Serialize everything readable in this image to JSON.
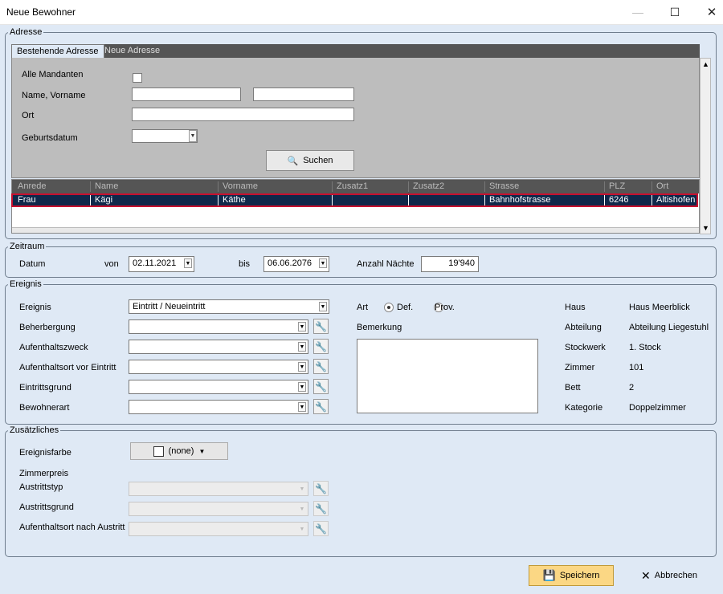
{
  "window": {
    "title": "Neue Bewohner",
    "minimize": "—",
    "maximize": "☐",
    "close": "✕"
  },
  "adresse": {
    "legend": "Adresse",
    "tabs": [
      "Bestehende Adresse",
      "Neue Adresse"
    ],
    "alle_mandanten_label": "Alle Mandanten",
    "name_vorname_label": "Name, Vorname",
    "ort_label": "Ort",
    "geburtsdatum_label": "Geburtsdatum",
    "suchen_label": "Suchen",
    "columns": [
      "Anrede",
      "Name",
      "Vorname",
      "Zusatz1",
      "Zusatz2",
      "Strasse",
      "PLZ",
      "Ort"
    ],
    "rows": [
      [
        "Frau",
        "Kägi",
        "Käthe",
        "",
        "",
        "Bahnhofstrasse",
        "6246",
        "Altishofen"
      ]
    ]
  },
  "zeitraum": {
    "legend": "Zeitraum",
    "datum_label": "Datum",
    "von_label": "von",
    "von_value": "02.11.2021",
    "bis_label": "bis",
    "bis_value": "06.06.2076",
    "naechte_label": "Anzahl Nächte",
    "naechte_value": "19'940"
  },
  "ereignis": {
    "legend": "Ereignis",
    "ereignis_label": "Ereignis",
    "ereignis_value": "Eintritt / Neueintritt",
    "beherbergung_label": "Beherbergung",
    "aufenthaltszweck_label": "Aufenthaltszweck",
    "aufenthaltsort_label": "Aufenthaltsort vor Eintritt",
    "eintrittsgrund_label": "Eintrittsgrund",
    "bewohnerart_label": "Bewohnerart",
    "art_label": "Art",
    "def_label": "Def.",
    "prov_label": "Prov.",
    "bemerkung_label": "Bemerkung",
    "info": [
      {
        "label": "Haus",
        "value": "Haus Meerblick"
      },
      {
        "label": "Abteilung",
        "value": "Abteilung Liegestuhl"
      },
      {
        "label": "Stockwerk",
        "value": "1. Stock"
      },
      {
        "label": "Zimmer",
        "value": "101"
      },
      {
        "label": "Bett",
        "value": "2"
      },
      {
        "label": "Kategorie",
        "value": "Doppelzimmer"
      }
    ]
  },
  "zusaetzliches": {
    "legend": "Zusätzliches",
    "ereignisfarbe_label": "Ereignisfarbe",
    "ereignisfarbe_value": "(none)",
    "zimmerpreis_label": "Zimmerpreis",
    "austrittstyp_label": "Austrittstyp",
    "austrittsgrund_label": "Austrittsgrund",
    "aufenthaltsort_nach_label": "Aufenthaltsort nach Austritt"
  },
  "footer": {
    "speichern_label": "Speichern",
    "abbrechen_label": "Abbrechen"
  },
  "colors": {
    "window_bg": "#dfe9f5",
    "selected_row": "#10284a",
    "selection_outline": "#c8102e",
    "save_button": "#fbd784"
  }
}
